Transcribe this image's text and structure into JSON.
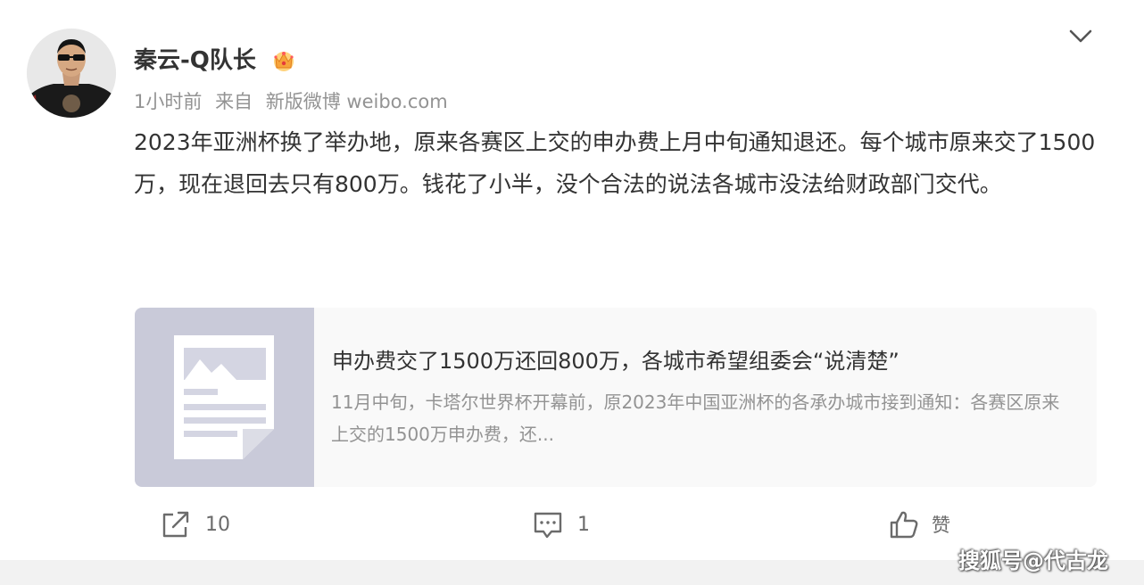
{
  "post": {
    "author": "秦云-Q队长",
    "badge_icon": "crown-badge-icon",
    "time": "1小时前",
    "source_prefix": "来自",
    "source": "新版微博 weibo.com",
    "text": "2023年亚洲杯换了举办地，原来各赛区上交的申办费上月中旬通知退还。每个城市原来交了1500万，现在退回去只有800万。钱花了小半，没个合法的说法各城市没法给财政部门交代。"
  },
  "link_card": {
    "title": "申办费交了1500万还回800万，各城市希望组委会“说清楚”",
    "description": "11月中旬，卡塔尔世界杯开幕前，原2023年中国亚洲杯的各承办城市接到通知：各赛区原来上交的1500万申办费，还..."
  },
  "actions": {
    "repost_count": "10",
    "comment_count": "1",
    "like_label": "赞"
  },
  "watermark": "搜狐号@代古龙",
  "colors": {
    "text": "#333333",
    "meta": "#939393",
    "card_bg": "#f9f9f9",
    "thumb_bg": "#c9cad9"
  }
}
